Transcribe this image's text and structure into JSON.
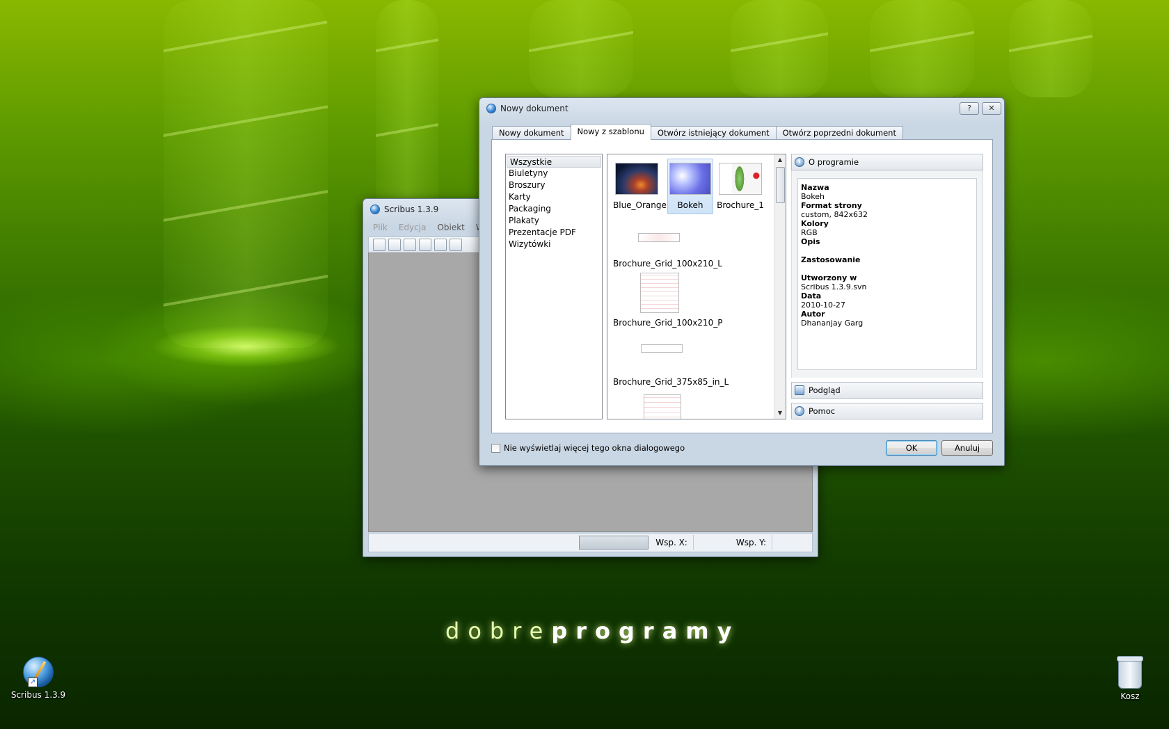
{
  "desktop": {
    "brand_light": "dobre",
    "brand_bold": "programy",
    "icons": [
      {
        "label": "Scribus 1.3.9",
        "icon": "scribus-icon"
      },
      {
        "label": "Kosz",
        "icon": "recycle-bin-icon"
      }
    ]
  },
  "scribus_window": {
    "title": "Scribus 1.3.9",
    "menu": [
      "Plik",
      "Edycja",
      "Obiekt",
      "Ws"
    ],
    "status": {
      "x_label": "Wsp. X:",
      "y_label": "Wsp. Y:"
    }
  },
  "dialog": {
    "title": "Nowy dokument",
    "help_button": "?",
    "close_button": "✕",
    "tabs": [
      "Nowy dokument",
      "Nowy z szablonu",
      "Otwórz istniejący dokument",
      "Otwórz poprzedni dokument"
    ],
    "active_tab": "Nowy z szablonu",
    "categories": [
      "Wszystkie",
      "Biuletyny",
      "Broszury",
      "Karty",
      "Packaging",
      "Plakaty",
      "Prezentacje PDF",
      "Wizytówki"
    ],
    "selected_category": "Wszystkie",
    "templates": [
      "Blue_Orange",
      "Bokeh",
      "Brochure_1",
      "Brochure_Grid_100x210_L",
      "Brochure_Grid_100x210_P",
      "Brochure_Grid_375x85_in_L"
    ],
    "selected_template": "Bokeh",
    "about_header": "O programie",
    "info": {
      "name_label": "Nazwa",
      "name_value": "Bokeh",
      "format_label": "Format strony",
      "format_value": "custom, 842x632",
      "colors_label": "Kolory",
      "colors_value": "RGB",
      "desc_label": "Opis",
      "usage_label": "Zastosowanie",
      "created_label": "Utworzony w",
      "created_value": "Scribus 1.3.9.svn",
      "date_label": "Data",
      "date_value": "2010-10-27",
      "author_label": "Autor",
      "author_value": "Dhananjay Garg"
    },
    "preview_header": "Podgląd",
    "help_header": "Pomoc",
    "dont_show_label": "Nie wyświetlaj więcej tego okna dialogowego",
    "ok_label": "OK",
    "cancel_label": "Anuluj"
  }
}
